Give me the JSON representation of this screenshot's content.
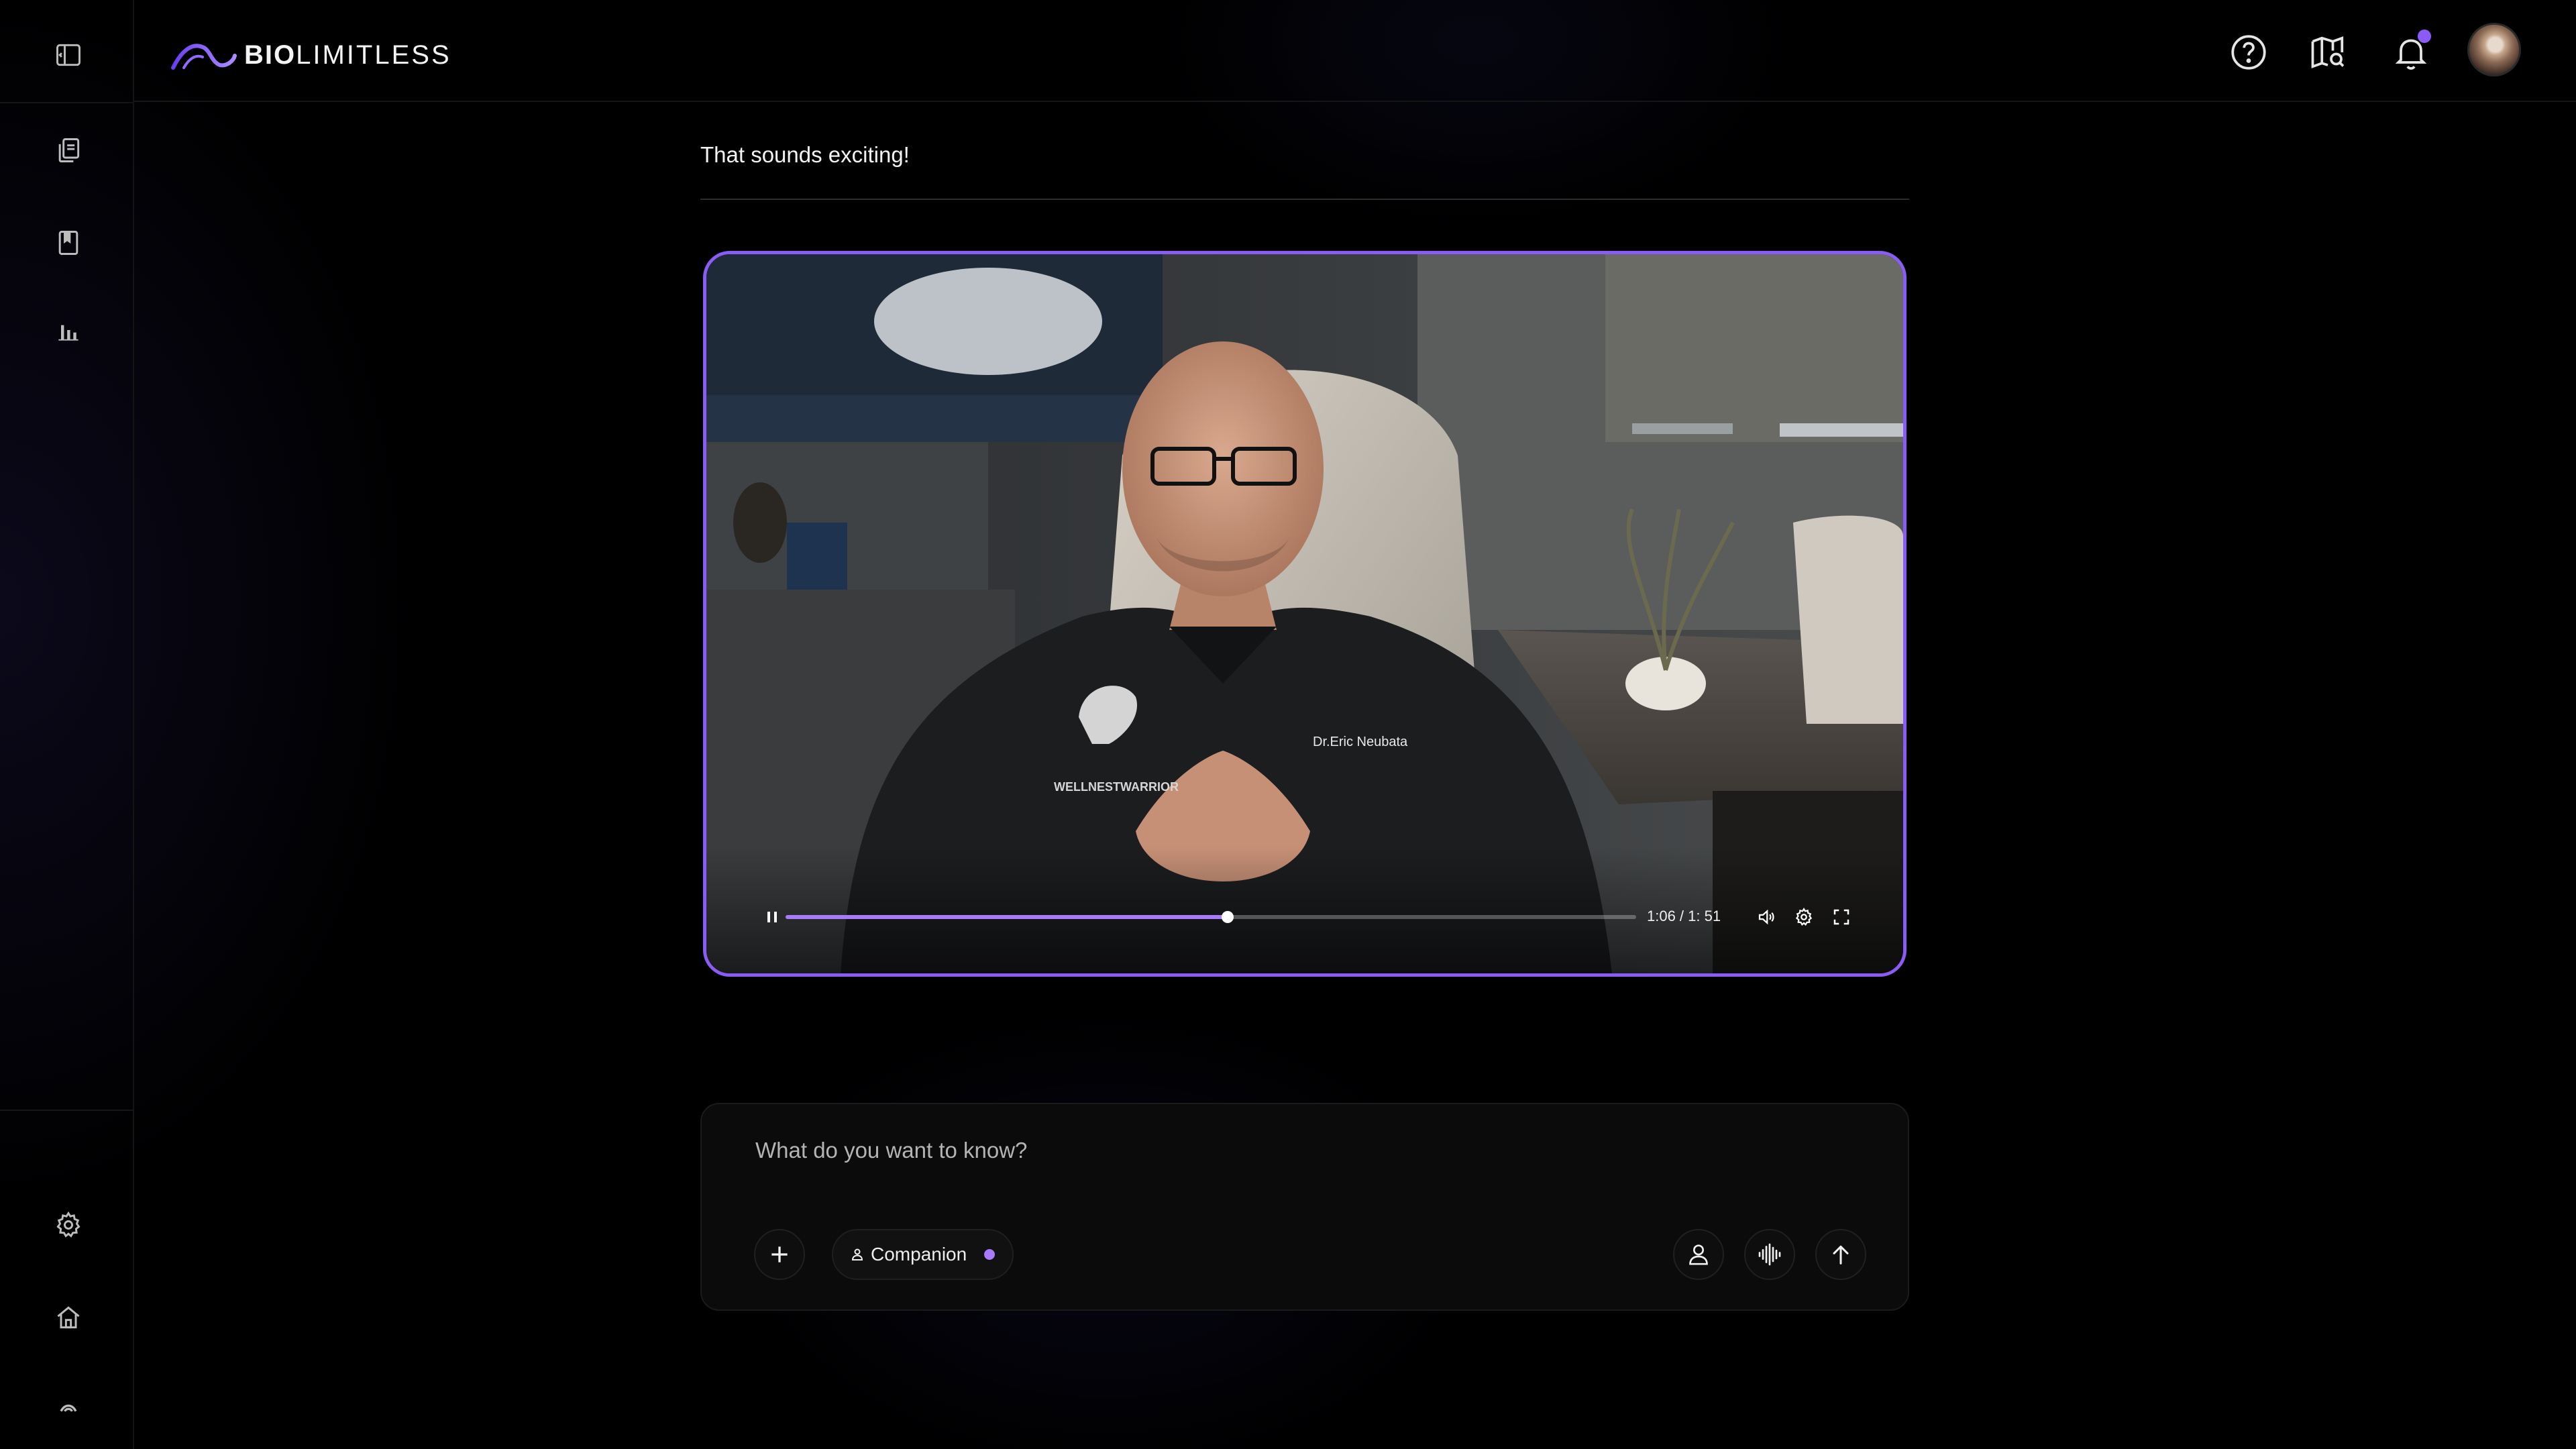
{
  "app": {
    "brand_bold": "BIO",
    "brand_light": "LIMITLESS"
  },
  "sidebar": {
    "items": [
      {
        "name": "toggle-sidebar",
        "icon": "sidebar-toggle-icon"
      },
      {
        "name": "copy",
        "icon": "copy-icon"
      },
      {
        "name": "bookmark",
        "icon": "bookmark-icon"
      },
      {
        "name": "stats",
        "icon": "bar-chart-icon"
      },
      {
        "name": "settings",
        "icon": "gear-icon"
      },
      {
        "name": "home",
        "icon": "home-icon"
      },
      {
        "name": "logo-mark",
        "icon": "logo-mark-icon"
      }
    ]
  },
  "header": {
    "icons": [
      "help-icon",
      "map-search-icon",
      "bell-icon",
      "avatar"
    ],
    "notification_dot_color": "#8a5cf5"
  },
  "conversation": {
    "message": "That sounds exciting!"
  },
  "video": {
    "name_label": "Dr.Eric Neubata",
    "shirt_text": "WELLNESTWARRIOR",
    "time": "1:06 / 1: 51",
    "progress": 0.52,
    "playing": true,
    "border_color": "#8a5cf5",
    "progress_color": "#a77af8"
  },
  "composer": {
    "placeholder": "What do you want to know?",
    "mode_label": "Companion",
    "mode_dot_color": "#a77af8"
  }
}
